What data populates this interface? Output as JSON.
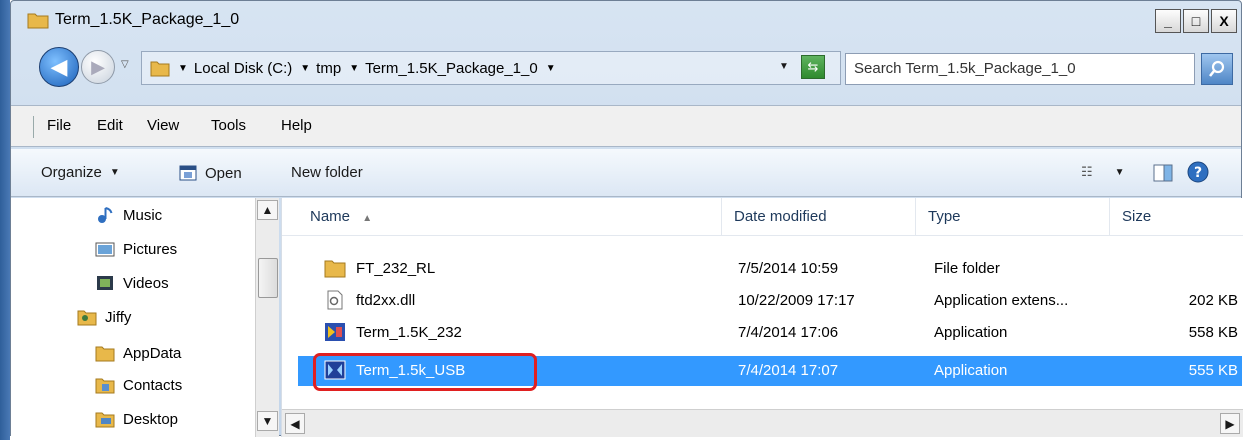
{
  "window": {
    "title": "Term_1.5K_Package_1_0",
    "buttons": {
      "minimize": "_",
      "maximize": "□",
      "close": "X"
    }
  },
  "address": {
    "crumbs": [
      "Local Disk (C:)",
      "tmp",
      "Term_1.5K_Package_1_0"
    ],
    "search_placeholder": "Search Term_1.5k_Package_1_0"
  },
  "menu": [
    "File",
    "Edit",
    "View",
    "Tools",
    "Help"
  ],
  "toolbar": {
    "organize": "Organize",
    "open": "Open",
    "new_folder": "New folder"
  },
  "nav_pane": {
    "items": [
      {
        "label": "Music",
        "icon": "music-icon"
      },
      {
        "label": "Pictures",
        "icon": "pictures-icon"
      },
      {
        "label": "Videos",
        "icon": "videos-icon"
      },
      {
        "label": "Jiffy",
        "icon": "user-folder-icon"
      },
      {
        "label": "AppData",
        "icon": "folder-icon"
      },
      {
        "label": "Contacts",
        "icon": "contacts-icon"
      },
      {
        "label": "Desktop",
        "icon": "desktop-icon"
      }
    ]
  },
  "columns": {
    "name": "Name",
    "date": "Date modified",
    "type": "Type",
    "size": "Size"
  },
  "files": [
    {
      "name": "FT_232_RL",
      "date": "7/5/2014 10:59",
      "type": "File folder",
      "size": "",
      "icon": "folder-icon"
    },
    {
      "name": "ftd2xx.dll",
      "date": "10/22/2009 17:17",
      "type": "Application extens...",
      "size": "202 KB",
      "icon": "dll-icon"
    },
    {
      "name": "Term_1.5K_232",
      "date": "7/4/2014 17:06",
      "type": "Application",
      "size": "558 KB",
      "icon": "application-icon"
    },
    {
      "name": "Term_1.5k_USB",
      "date": "7/4/2014 17:07",
      "type": "Application",
      "size": "555 KB",
      "icon": "application-icon"
    }
  ],
  "selected_file": "Term_1.5k_USB",
  "colors": {
    "selection": "#3399ff",
    "annotation_ring": "#e02020",
    "header_text": "#1e395b"
  }
}
